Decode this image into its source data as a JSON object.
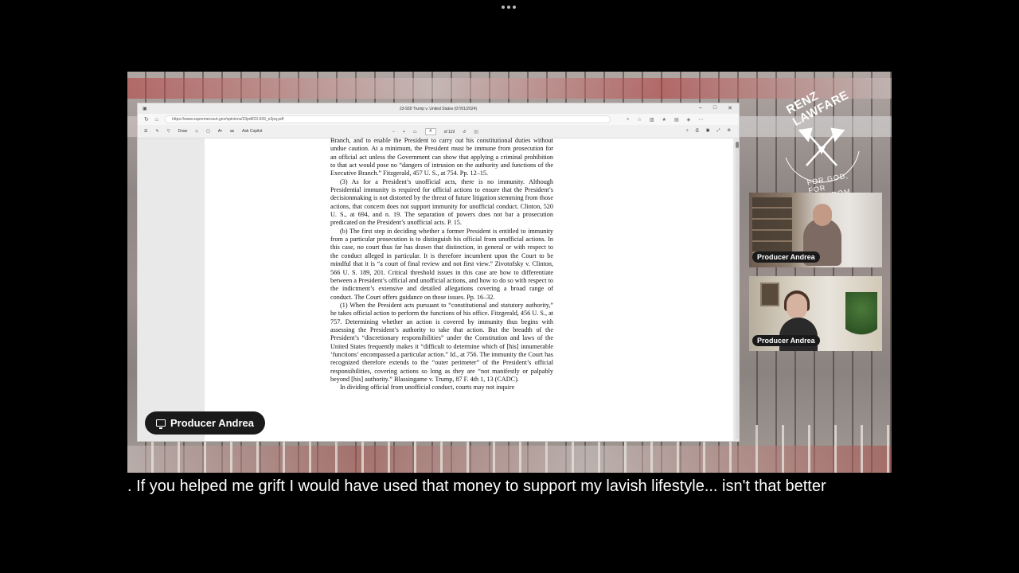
{
  "window": {
    "tab_title": "23-939 Trump v. United States (07/01/2024)",
    "url": "https://www.supremecourt.gov/opinions/23pdf/23-939_e2pq.pdf",
    "controls": [
      "–",
      "□",
      "✕"
    ]
  },
  "pdf_toolbar": {
    "draw_label": "Draw",
    "ask_label": "Ask Copilot",
    "page_current": "4",
    "page_total": "of 119"
  },
  "opinion_paragraphs": [
    "Branch, and to enable the President to carry out his constitutional duties without undue caution. At a minimum, the President must be immune from prosecution for an official act unless the Government can show that applying a criminal prohibition to that act would pose no “dangers of intrusion on the authority and functions of the Executive Branch.” Fitzgerald, 457 U. S., at 754. Pp. 12–15.",
    "(3) As for a President’s unofficial acts, there is no immunity. Although Presidential immunity is required for official actions to ensure that the President’s decisionmaking is not distorted by the threat of future litigation stemming from those actions, that concern does not support immunity for unofficial conduct. Clinton, 520 U. S., at 694, and n. 19. The separation of powers does not bar a prosecution predicated on the President’s unofficial acts. P. 15.",
    "(b) The first step in deciding whether a former President is entitled to immunity from a particular prosecution is to distinguish his official from unofficial actions. In this case, no court thus far has drawn that distinction, in general or with respect to the conduct alleged in particular. It is therefore incumbent upon the Court to be mindful that it is “a court of final review and not first view.” Zivotofsky v. Clinton, 566 U. S. 189, 201. Critical threshold issues in this case are how to differentiate between a President’s official and unofficial actions, and how to do so with respect to the indictment’s extensive and detailed allegations covering a broad range of conduct. The Court offers guidance on those issues. Pp. 16–32.",
    "(1) When the President acts pursuant to “constitutional and statutory authority,” he takes official action to perform the functions of his office. Fitzgerald, 456 U. S., at 757. Determining whether an action is covered by immunity thus begins with assessing the President’s authority to take that action. But the breadth of the President’s “discretionary responsibilities” under the Constitution and laws of the United States frequently makes it “difficult to determine which of [his] innumerable ‘functions’ encompassed a particular action.” Id., at 756. The immunity the Court has recognized therefore extends to the “outer perimeter” of the President’s official responsibilities, covering actions so long as they are “not manifestly or palpably beyond [his] authority.” Blassingame v. Trump, 87 F. 4th 1, 13 (CADC).",
    "In dividing official from unofficial conduct, courts may not inquire"
  ],
  "screen_share_label": "Producer Andrea",
  "logo": {
    "title": "RENZ LAWFARE",
    "motto": "FOR GOD, FOR FREEDOM"
  },
  "participants": [
    {
      "name": "Producer Andrea"
    },
    {
      "name": "Producer Andrea"
    }
  ],
  "caption": ". If you helped me grift I would have used that money to support my lavish lifestyle... isn't that better"
}
